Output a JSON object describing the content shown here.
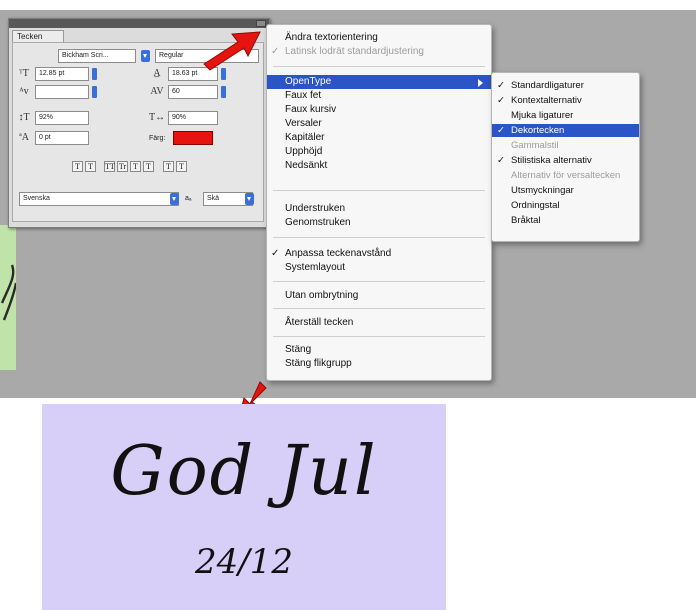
{
  "panel": {
    "tab_label": "Tecken",
    "font_family": "Bickham Scri...",
    "font_style": "Regular",
    "font_size": "12.85 pt",
    "leading": "18.63 pt",
    "tracking": "60",
    "vertical_scale": "92%",
    "horizontal_scale": "90%",
    "baseline_shift": "0 pt",
    "color_label": "Färg:",
    "color_value": "#e5140e",
    "style_buttons": [
      "T",
      "T",
      "TT",
      "Tr",
      "T",
      "T",
      "T",
      "T"
    ],
    "language": "Svenska",
    "aa_label": "aₐ",
    "aa_value": "Skä"
  },
  "menu": {
    "items": [
      {
        "label": "Ändra textorientering",
        "checked": false,
        "disabled": false
      },
      {
        "label": "Latinsk lodrät standardjustering",
        "checked": true,
        "disabled": true
      },
      {
        "label": "OpenType",
        "checked": false,
        "disabled": false,
        "highlighted": true,
        "has_submenu": true
      },
      {
        "label": "Faux fet",
        "checked": false,
        "disabled": false
      },
      {
        "label": "Faux kursiv",
        "checked": false,
        "disabled": false
      },
      {
        "label": "Versaler",
        "checked": false,
        "disabled": false
      },
      {
        "label": "Kapitäler",
        "checked": false,
        "disabled": false
      },
      {
        "label": "Upphöjd",
        "checked": false,
        "disabled": false
      },
      {
        "label": "Nedsänkt",
        "checked": false,
        "disabled": false
      },
      {
        "label": "Understruken",
        "checked": false,
        "disabled": false
      },
      {
        "label": "Genomstruken",
        "checked": false,
        "disabled": false
      },
      {
        "label": "Anpassa teckenavstånd",
        "checked": true,
        "disabled": false
      },
      {
        "label": "Systemlayout",
        "checked": false,
        "disabled": false
      },
      {
        "label": "Utan ombrytning",
        "checked": false,
        "disabled": false
      },
      {
        "label": "Återställ tecken",
        "checked": false,
        "disabled": false
      },
      {
        "label": "Stäng",
        "checked": false,
        "disabled": false
      },
      {
        "label": "Stäng flikgrupp",
        "checked": false,
        "disabled": false
      }
    ]
  },
  "submenu": {
    "items": [
      {
        "label": "Standardligaturer",
        "checked": true,
        "disabled": false
      },
      {
        "label": "Kontextalternativ",
        "checked": true,
        "disabled": false
      },
      {
        "label": "Mjuka ligaturer",
        "checked": false,
        "disabled": false
      },
      {
        "label": "Dekortecken",
        "checked": true,
        "disabled": false,
        "highlighted": true
      },
      {
        "label": "Gammalstil",
        "checked": false,
        "disabled": true
      },
      {
        "label": "Stilistiska alternativ",
        "checked": true,
        "disabled": false
      },
      {
        "label": "Alternativ för versaltecken",
        "checked": false,
        "disabled": true
      },
      {
        "label": "Utsmyckningar",
        "checked": false,
        "disabled": false
      },
      {
        "label": "Ordningstal",
        "checked": false,
        "disabled": false
      },
      {
        "label": "Bråktal",
        "checked": false,
        "disabled": false
      }
    ]
  },
  "card": {
    "title": "God Jul",
    "date": "24/12",
    "background": "#d7cff7"
  },
  "colors": {
    "accent": "#2b54c6",
    "callout_arrow": "#e5140e",
    "backdrop": "#a9a9a9"
  },
  "icons": {
    "check": "✓",
    "callout": "arrow-callout-icon"
  }
}
